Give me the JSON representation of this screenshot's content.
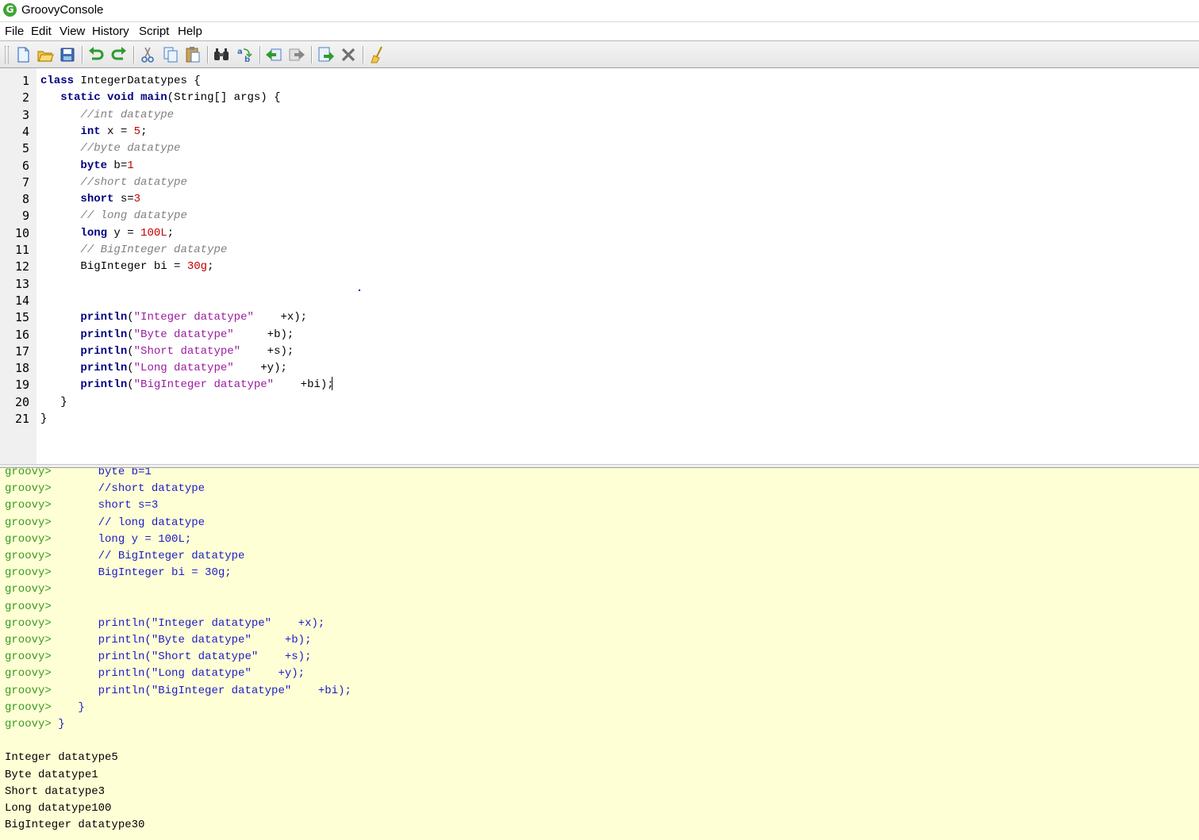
{
  "window": {
    "title": "GroovyConsole",
    "icon_letter": "G"
  },
  "menu": [
    "File",
    "Edit",
    "View",
    "History",
    "Script",
    "Help"
  ],
  "toolbar": {
    "buttons": [
      "new-file-icon",
      "open-file-icon",
      "save-icon",
      "undo-icon",
      "redo-icon",
      "cut-icon",
      "copy-icon",
      "paste-icon",
      "find-icon",
      "replace-icon",
      "history-previous-icon",
      "history-next-icon",
      "run-script-icon",
      "interrupt-icon",
      "clear-output-icon"
    ]
  },
  "editor": {
    "line_numbers": [
      "1",
      "2",
      "3",
      "4",
      "5",
      "6",
      "7",
      "8",
      "9",
      "10",
      "11",
      "12",
      "13",
      "14",
      "15",
      "16",
      "17",
      "18",
      "19",
      "20",
      "21"
    ],
    "lines": [
      [
        {
          "t": "class",
          "c": "kw"
        },
        {
          "t": " IntegerDatatypes {",
          "c": ""
        }
      ],
      [
        {
          "t": "   ",
          "c": ""
        },
        {
          "t": "static",
          "c": "kw"
        },
        {
          "t": " ",
          "c": ""
        },
        {
          "t": "void",
          "c": "kw"
        },
        {
          "t": " ",
          "c": ""
        },
        {
          "t": "main",
          "c": "kw"
        },
        {
          "t": "(String[] args) {",
          "c": ""
        }
      ],
      [
        {
          "t": "      ",
          "c": ""
        },
        {
          "t": "//int datatype",
          "c": "cm"
        }
      ],
      [
        {
          "t": "      ",
          "c": ""
        },
        {
          "t": "int",
          "c": "kw"
        },
        {
          "t": " x = ",
          "c": ""
        },
        {
          "t": "5",
          "c": "num"
        },
        {
          "t": ";",
          "c": ""
        }
      ],
      [
        {
          "t": "      ",
          "c": ""
        },
        {
          "t": "//byte datatype",
          "c": "cm"
        }
      ],
      [
        {
          "t": "      ",
          "c": ""
        },
        {
          "t": "byte",
          "c": "kw"
        },
        {
          "t": " b=",
          "c": ""
        },
        {
          "t": "1",
          "c": "num"
        }
      ],
      [
        {
          "t": "      ",
          "c": ""
        },
        {
          "t": "//short datatype",
          "c": "cm"
        }
      ],
      [
        {
          "t": "      ",
          "c": ""
        },
        {
          "t": "short",
          "c": "kw"
        },
        {
          "t": " s=",
          "c": ""
        },
        {
          "t": "3",
          "c": "num"
        }
      ],
      [
        {
          "t": "      ",
          "c": ""
        },
        {
          "t": "// long datatype",
          "c": "cm"
        }
      ],
      [
        {
          "t": "      ",
          "c": ""
        },
        {
          "t": "long",
          "c": "kw"
        },
        {
          "t": " y = ",
          "c": ""
        },
        {
          "t": "100L",
          "c": "num"
        },
        {
          "t": ";",
          "c": ""
        }
      ],
      [
        {
          "t": "      ",
          "c": ""
        },
        {
          "t": "// BigInteger datatype",
          "c": "cm"
        }
      ],
      [
        {
          "t": "      BigInteger bi = ",
          "c": ""
        },
        {
          "t": "30g",
          "c": "num"
        },
        {
          "t": ";",
          "c": ""
        }
      ],
      [],
      [],
      [
        {
          "t": "      ",
          "c": ""
        },
        {
          "t": "println",
          "c": "kw"
        },
        {
          "t": "(",
          "c": ""
        },
        {
          "t": "\"Integer datatype\"",
          "c": "str"
        },
        {
          "t": "    +x);",
          "c": ""
        }
      ],
      [
        {
          "t": "      ",
          "c": ""
        },
        {
          "t": "println",
          "c": "kw"
        },
        {
          "t": "(",
          "c": ""
        },
        {
          "t": "\"Byte datatype\"",
          "c": "str"
        },
        {
          "t": "     +b);",
          "c": ""
        }
      ],
      [
        {
          "t": "      ",
          "c": ""
        },
        {
          "t": "println",
          "c": "kw"
        },
        {
          "t": "(",
          "c": ""
        },
        {
          "t": "\"Short datatype\"",
          "c": "str"
        },
        {
          "t": "    +s);",
          "c": ""
        }
      ],
      [
        {
          "t": "      ",
          "c": ""
        },
        {
          "t": "println",
          "c": "kw"
        },
        {
          "t": "(",
          "c": ""
        },
        {
          "t": "\"Long datatype\"",
          "c": "str"
        },
        {
          "t": "    +y);",
          "c": ""
        }
      ],
      [
        {
          "t": "      ",
          "c": ""
        },
        {
          "t": "println",
          "c": "kw"
        },
        {
          "t": "(",
          "c": ""
        },
        {
          "t": "\"BigInteger datatype\"",
          "c": "str"
        },
        {
          "t": "    +bi);",
          "c": ""
        }
      ],
      [
        {
          "t": "   }",
          "c": ""
        }
      ],
      [
        {
          "t": "}",
          "c": ""
        }
      ]
    ]
  },
  "output": {
    "prompt": "groovy>",
    "echo_lines": [
      "      byte b=1",
      "      //short datatype",
      "      short s=3",
      "      // long datatype",
      "      long y = 100L;",
      "      // BigInteger datatype",
      "      BigInteger bi = 30g;",
      "",
      "",
      "      println(\"Integer datatype\"    +x);",
      "      println(\"Byte datatype\"     +b);",
      "      println(\"Short datatype\"    +s);",
      "      println(\"Long datatype\"    +y);",
      "      println(\"BigInteger datatype\"    +bi);",
      "   }",
      "}"
    ],
    "results": [
      "Integer datatype5",
      "Byte datatype1",
      "Short datatype3",
      "Long datatype100",
      "BigInteger datatype30"
    ]
  }
}
